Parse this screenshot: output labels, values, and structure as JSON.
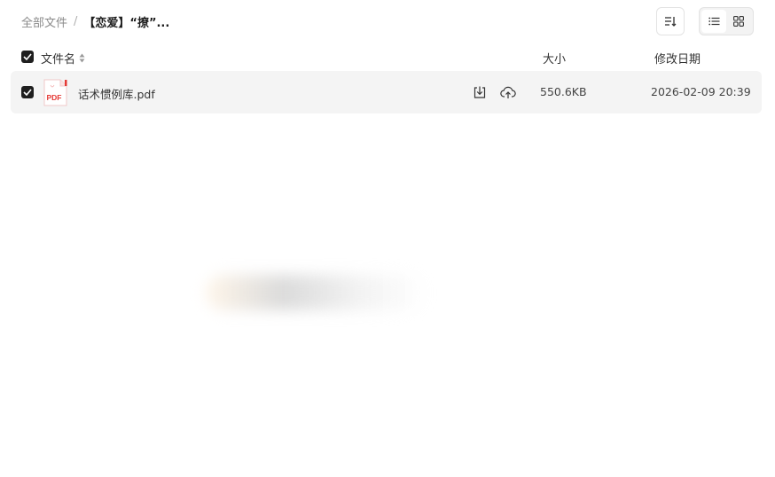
{
  "breadcrumb": {
    "root": "全部文件",
    "separator": "/",
    "current": "【恋爱】“撩”..."
  },
  "toolbar": {
    "sort_icon": "sort-icon",
    "view_list_icon": "list-view-icon",
    "view_grid_icon": "grid-view-icon",
    "active_view": "list"
  },
  "table": {
    "columns": {
      "name": "文件名",
      "size": "大小",
      "date": "修改日期"
    },
    "rows": [
      {
        "checked": true,
        "icon": "pdf-file-icon",
        "icon_text": "PDF",
        "name": "话术惯例库.pdf",
        "size": "550.6KB",
        "modified": "2026-02-09 20:39"
      }
    ]
  },
  "colors": {
    "accent_dark": "#1f1f1f",
    "row_bg": "#f4f4f4",
    "pdf_red": "#e53935"
  }
}
